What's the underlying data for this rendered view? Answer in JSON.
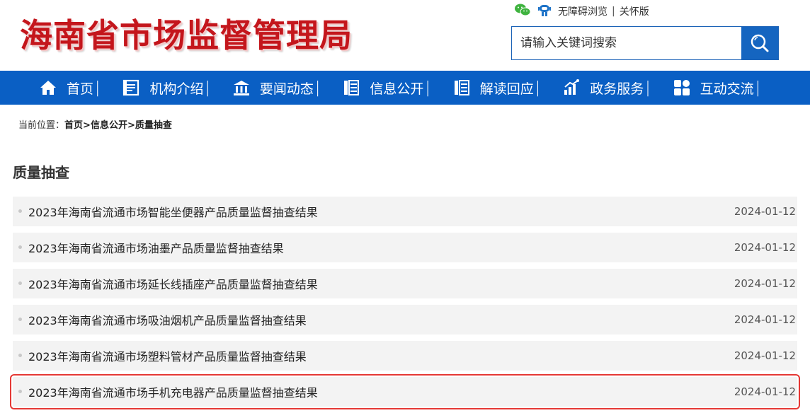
{
  "header": {
    "logo": "海南省市场监督管理局",
    "accessibility": "无障碍浏览",
    "separator": "|",
    "care_mode": "关怀版",
    "search_placeholder": "请输入关键词搜索"
  },
  "nav": {
    "items": [
      {
        "label": "首页",
        "icon": "home-icon"
      },
      {
        "label": "机构介绍",
        "icon": "building-doc-icon"
      },
      {
        "label": "要闻动态",
        "icon": "bank-icon"
      },
      {
        "label": "信息公开",
        "icon": "book-icon"
      },
      {
        "label": "解读回应",
        "icon": "list-book-icon"
      },
      {
        "label": "政务服务",
        "icon": "chart-icon"
      },
      {
        "label": "互动交流",
        "icon": "grid-icon"
      }
    ],
    "divider": "|"
  },
  "breadcrumb": {
    "prefix": "当前位置：",
    "home": "首页",
    "sep1": ">",
    "level1": "信息公开",
    "sep2": ">",
    "current": "质量抽查"
  },
  "section_title": "质量抽查",
  "list": [
    {
      "title": "2023年海南省流通市场智能坐便器产品质量监督抽查结果",
      "date": "2024-01-12"
    },
    {
      "title": "2023年海南省流通市场油墨产品质量监督抽查结果",
      "date": "2024-01-12"
    },
    {
      "title": "2023年海南省流通市场延长线插座产品质量监督抽查结果",
      "date": "2024-01-12"
    },
    {
      "title": "2023年海南省流通市场吸油烟机产品质量监督抽查结果",
      "date": "2024-01-12"
    },
    {
      "title": "2023年海南省流通市场塑料管材产品质量监督抽查结果",
      "date": "2024-01-12"
    },
    {
      "title": "2023年海南省流通市场手机充电器产品质量监督抽查结果",
      "date": "2024-01-12"
    }
  ],
  "colors": {
    "brand_red": "#c4161c",
    "nav_blue": "#0a5fc4",
    "search_blue": "#1565c0",
    "highlight_red": "#e53935"
  }
}
